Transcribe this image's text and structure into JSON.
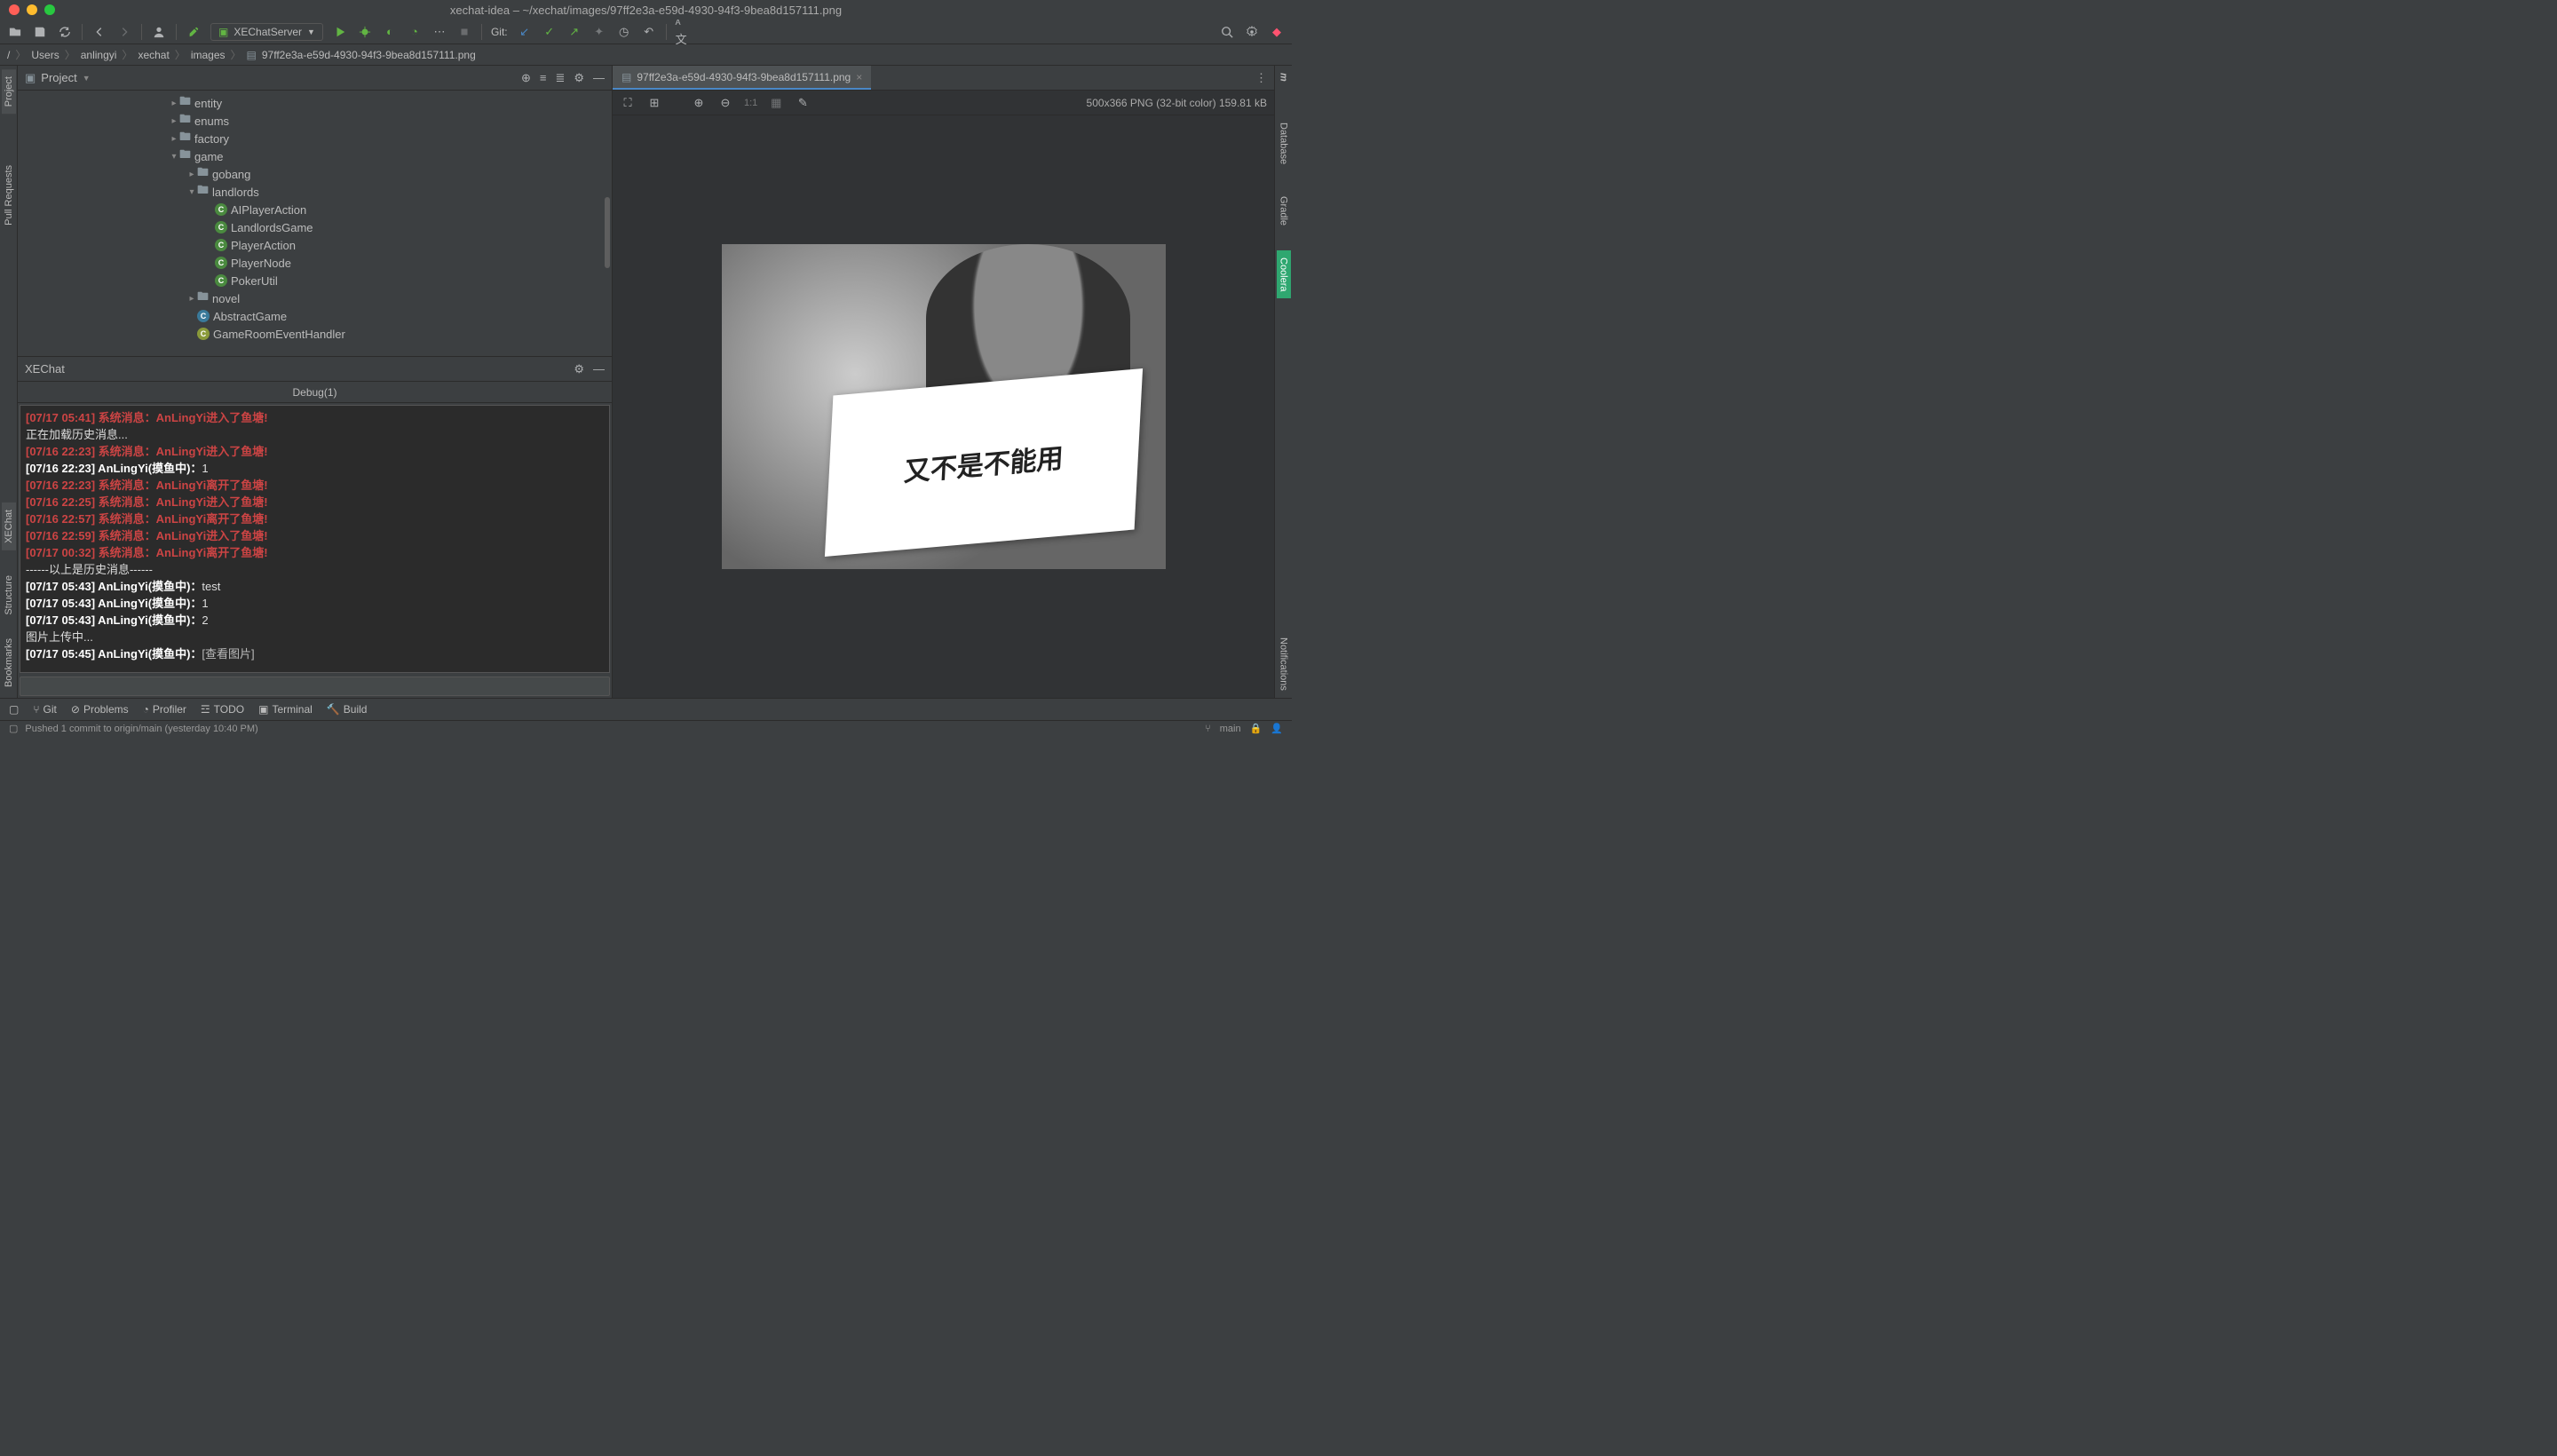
{
  "window": {
    "title": "xechat-idea – ~/xechat/images/97ff2e3a-e59d-4930-94f3-9bea8d157111.png"
  },
  "toolbar": {
    "run_config": "XEChatServer",
    "git_label": "Git:"
  },
  "breadcrumb": [
    "/",
    "Users",
    "anlingyi",
    "xechat",
    "images",
    "97ff2e3a-e59d-4930-94f3-9bea8d157111.png"
  ],
  "left_tabs": {
    "project": "Project",
    "pull_requests": "Pull Requests",
    "xechat": "XEChat",
    "structure": "Structure",
    "bookmarks": "Bookmarks"
  },
  "right_tabs": {
    "maven": "Maven",
    "database": "Database",
    "gradle": "Gradle",
    "coolera": "Coolera",
    "notifications": "Notifications"
  },
  "project_panel": {
    "title": "Project"
  },
  "tree": {
    "entity": "entity",
    "enums": "enums",
    "factory": "factory",
    "game": "game",
    "gobang": "gobang",
    "landlords": "landlords",
    "c1": "AIPlayerAction",
    "c2": "LandlordsGame",
    "c3": "PlayerAction",
    "c4": "PlayerNode",
    "c5": "PokerUtil",
    "novel": "novel",
    "abstract_game": "AbstractGame",
    "game_room_handler": "GameRoomEventHandler"
  },
  "xechat": {
    "title": "XEChat",
    "tab": "Debug(1)",
    "messages": [
      {
        "type": "sys",
        "text": "[07/17 05:41] 系统消息：AnLingYi进入了鱼塘!"
      },
      {
        "type": "txt",
        "text": "正在加载历史消息..."
      },
      {
        "type": "sys",
        "text": "[07/16 22:23] 系统消息：AnLingYi进入了鱼塘!"
      },
      {
        "type": "usr",
        "prefix": "[07/16 22:23] AnLingYi(摸鱼中)：",
        "text": "1"
      },
      {
        "type": "sys",
        "text": "[07/16 22:23] 系统消息：AnLingYi离开了鱼塘!"
      },
      {
        "type": "sys",
        "text": "[07/16 22:25] 系统消息：AnLingYi进入了鱼塘!"
      },
      {
        "type": "sys",
        "text": "[07/16 22:57] 系统消息：AnLingYi离开了鱼塘!"
      },
      {
        "type": "sys",
        "text": "[07/16 22:59] 系统消息：AnLingYi进入了鱼塘!"
      },
      {
        "type": "sys",
        "text": "[07/17 00:32] 系统消息：AnLingYi离开了鱼塘!"
      },
      {
        "type": "txt",
        "text": "------以上是历史消息------"
      },
      {
        "type": "usr",
        "prefix": "[07/17 05:43] AnLingYi(摸鱼中)：",
        "text": "test"
      },
      {
        "type": "usr",
        "prefix": "[07/17 05:43] AnLingYi(摸鱼中)：",
        "text": "1"
      },
      {
        "type": "usr",
        "prefix": "[07/17 05:43] AnLingYi(摸鱼中)：",
        "text": "2"
      },
      {
        "type": "txt",
        "text": "图片上传中..."
      },
      {
        "type": "usr",
        "prefix": "[07/17 05:45] AnLingYi(摸鱼中)：",
        "text": "[查看图片]",
        "link": true
      }
    ]
  },
  "editor": {
    "tab": "97ff2e3a-e59d-4930-94f3-9bea8d157111.png",
    "info": "500x366 PNG (32-bit color) 159.81 kB",
    "ratio": "1:1",
    "sign_text": "又不是不能用"
  },
  "bottombar": {
    "git": "Git",
    "problems": "Problems",
    "profiler": "Profiler",
    "todo": "TODO",
    "terminal": "Terminal",
    "build": "Build"
  },
  "status": {
    "msg": "Pushed 1 commit to origin/main (yesterday 10:40 PM)",
    "branch": "main"
  }
}
